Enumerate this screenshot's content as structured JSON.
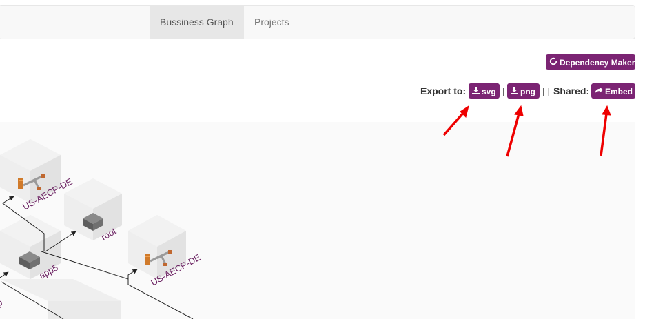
{
  "nav": {
    "tabs": [
      {
        "label": "Bussiness Graph",
        "active": true
      },
      {
        "label": "Projects",
        "active": false
      }
    ]
  },
  "toolbar": {
    "dependency_maker": "Dependency Maker",
    "export_label": "Export to:",
    "svg_label": "svg",
    "png_label": "png",
    "separator_1": "|",
    "separator_2": "| |",
    "shared_label": "Shared:",
    "embed_label": "Embed"
  },
  "graph": {
    "nodes": [
      {
        "label": "US-AECP-DE",
        "icon": "server-rack-icon"
      },
      {
        "label": "root",
        "icon": "switch-box-icon"
      },
      {
        "label": "app5",
        "icon": "switch-box-icon"
      },
      {
        "label": "US-AECP-DE",
        "icon": "server-rack-icon"
      },
      {
        "label": "p",
        "icon": "none"
      }
    ]
  },
  "colors": {
    "accent": "#7b2473",
    "annotation_arrow": "#ee0000",
    "node_label": "#6b2262"
  }
}
